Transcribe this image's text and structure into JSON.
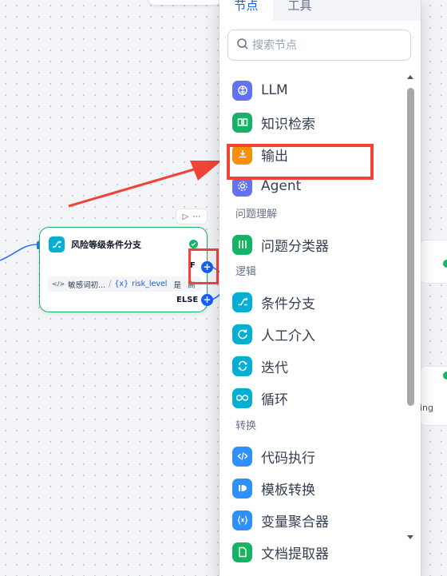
{
  "panel": {
    "tabs": [
      "节点",
      "工具"
    ],
    "active_tab": 0,
    "search_placeholder": "搜索节点",
    "items": [
      {
        "label": "LLM",
        "icon": "llm-icon",
        "color": "#6172f3"
      },
      {
        "label": "知识检索",
        "icon": "book-icon",
        "color": "#16b364"
      },
      {
        "label": "输出",
        "icon": "output-icon",
        "color": "#f79009"
      },
      {
        "label": "Agent",
        "icon": "agent-icon",
        "color": "#6172f3"
      },
      {
        "label": "问题分类器",
        "icon": "classifier-icon",
        "color": "#16b364"
      },
      {
        "label": "条件分支",
        "icon": "branch-icon",
        "color": "#06aed4"
      },
      {
        "label": "人工介入",
        "icon": "human-icon",
        "color": "#06aed4"
      },
      {
        "label": "迭代",
        "icon": "iteration-icon",
        "color": "#06aed4"
      },
      {
        "label": "循环",
        "icon": "loop-icon",
        "color": "#06aed4"
      },
      {
        "label": "代码执行",
        "icon": "code-icon",
        "color": "#2e90fa"
      },
      {
        "label": "模板转换",
        "icon": "template-icon",
        "color": "#2e90fa"
      },
      {
        "label": "变量聚合器",
        "icon": "variable-icon",
        "color": "#2e90fa"
      },
      {
        "label": "文档提取器",
        "icon": "doc-extractor-icon",
        "color": "#16b364"
      }
    ],
    "sections": [
      "问题理解",
      "逻辑",
      "转换"
    ]
  },
  "node": {
    "title": "风险等级条件分支",
    "if_label": "F",
    "else_label": "ELSE",
    "condition": {
      "variable": "敏感词初...",
      "separator": "/",
      "field_prefix": "{x}",
      "field": "risk_level",
      "operator": "是",
      "value": "高"
    }
  },
  "partial_node_text": "ing",
  "colors": {
    "accent": "#155eef",
    "success": "#16b364",
    "annotation": "#f04438"
  }
}
